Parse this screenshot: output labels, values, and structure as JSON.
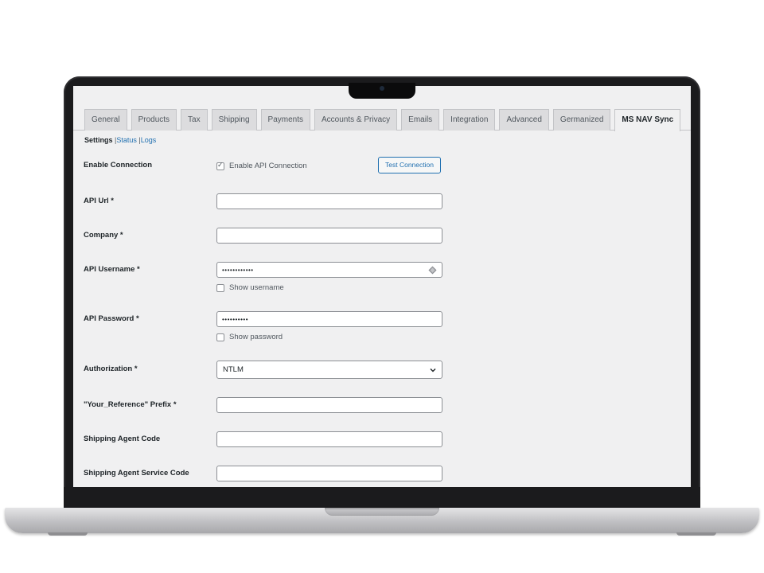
{
  "tabs": [
    "General",
    "Products",
    "Tax",
    "Shipping",
    "Payments",
    "Accounts & Privacy",
    "Emails",
    "Integration",
    "Advanced",
    "Germanized",
    "MS NAV Sync"
  ],
  "active_tab": "MS NAV Sync",
  "subnav": {
    "settings": "Settings",
    "sep1": "|",
    "status": "Status",
    "sep2": "|",
    "logs": "Logs"
  },
  "form": {
    "enable_connection": {
      "label": "Enable Connection",
      "checkbox_label": "Enable API Connection",
      "checked": true,
      "button": "Test Connection"
    },
    "api_url": {
      "label": "API Url *",
      "value": ""
    },
    "company": {
      "label": "Company *",
      "value": ""
    },
    "api_username": {
      "label": "API Username *",
      "masked_value": "••••••••••••",
      "show_label": "Show username",
      "show_checked": false,
      "icon": "key-icon"
    },
    "api_password": {
      "label": "API Password *",
      "masked_value": "••••••••••",
      "show_label": "Show password",
      "show_checked": false
    },
    "authorization": {
      "label": "Authorization *",
      "selected": "NTLM",
      "icon": "chevron-down-icon"
    },
    "your_reference_prefix": {
      "label": "\"Your_Reference\" Prefix *",
      "value": ""
    },
    "shipping_agent_code": {
      "label": "Shipping Agent Code",
      "value": ""
    },
    "shipping_agent_service_code": {
      "label": "Shipping Agent Service Code",
      "value": ""
    }
  },
  "colors": {
    "accent": "#2271b1",
    "screen_bg": "#f0f0f1",
    "laptop_bezel": "#1b1b1d"
  }
}
